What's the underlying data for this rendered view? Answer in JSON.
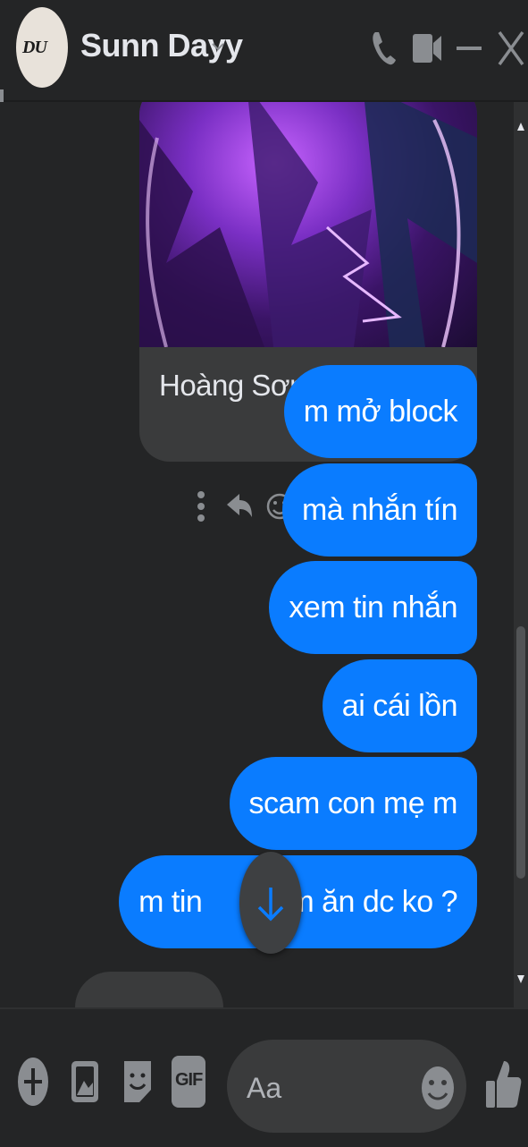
{
  "header": {
    "contact_name": "Sunn Dayy",
    "avatar_text": "DU"
  },
  "shared_card": {
    "label": "Hoàng Sơn"
  },
  "messages": [
    {
      "text": "m mở block",
      "sender": "me"
    },
    {
      "text": "mà nhắn tín",
      "sender": "me"
    },
    {
      "text": "xem tin nhắn",
      "sender": "me"
    },
    {
      "text": "ai cái lồn",
      "sender": "me"
    },
    {
      "text": "scam con mẹ m",
      "sender": "me"
    },
    {
      "text": "m tin        làm ăn dc ko ?",
      "sender": "me"
    }
  ],
  "composer": {
    "placeholder": "Aa",
    "gif_label": "GIF"
  },
  "colors": {
    "accent": "#0a7cff",
    "background": "#242526",
    "received_bubble": "#3a3b3c"
  }
}
